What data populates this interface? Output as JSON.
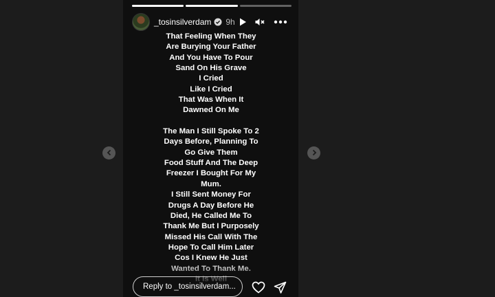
{
  "progress": [
    1,
    1,
    0
  ],
  "header": {
    "username": "_tosinsilverdam",
    "time": "9h",
    "icons": [
      "play-icon",
      "mute-icon",
      "more-icon"
    ]
  },
  "story_lines": [
    "That Feeling When They",
    "Are Burying Your Father",
    "And You Have To Pour",
    "Sand On His Grave",
    "I Cried",
    "Like I Cried",
    "That Was When It",
    "Dawned On Me",
    "",
    "The Man I Still Spoke To 2",
    "Days Before, Planning To",
    "Go Give  Them",
    "Food Stuff And The Deep",
    "Freezer I Bought For My",
    "Mum.",
    "I Still Sent Money For",
    "Drugs A Day Before He",
    "Died, He Called Me To",
    "Thank Me But I Purposely",
    "Missed His Call With The",
    "Hope To Call Him Later",
    "Cos I Knew He Just",
    "Wanted To Thank Me.",
    "It Is Well"
  ],
  "footer": {
    "reply_placeholder": "Reply to _tosinsilverdam...",
    "icons": [
      "heart-icon",
      "send-icon"
    ]
  },
  "nav": {
    "prev_icon": "chevron-left-icon",
    "next_icon": "chevron-right-icon"
  }
}
